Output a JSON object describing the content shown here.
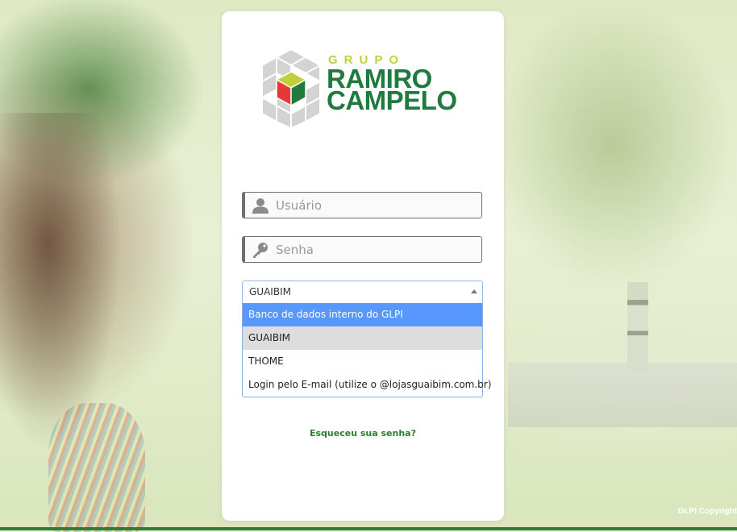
{
  "logo": {
    "grupo": "GRUPO",
    "line1": "RAMIRO",
    "line2": "CAMPELO",
    "colors": {
      "green": "#1f7a3d",
      "lime": "#c3cf3a",
      "red": "#e53935",
      "cube_gray": "#cfcfcf"
    }
  },
  "login": {
    "username_placeholder": "Usuário",
    "password_placeholder": "Senha",
    "username_icon": "user-icon",
    "password_icon": "key-icon"
  },
  "auth_source": {
    "selected": "GUAIBIM",
    "options": [
      "Banco de dados interno do GLPI",
      "GUAIBIM",
      "THOME",
      "Login pelo E-mail (utilize o @lojasguaibim.com.br)"
    ],
    "highlighted_index": 0,
    "selected_index": 1
  },
  "forgot_password": "Esqueceu sua senha?",
  "footer": {
    "copyright": "GLPI Copyright"
  },
  "colors": {
    "accent_green": "#2e7d32",
    "highlight_blue": "#5897fb"
  }
}
